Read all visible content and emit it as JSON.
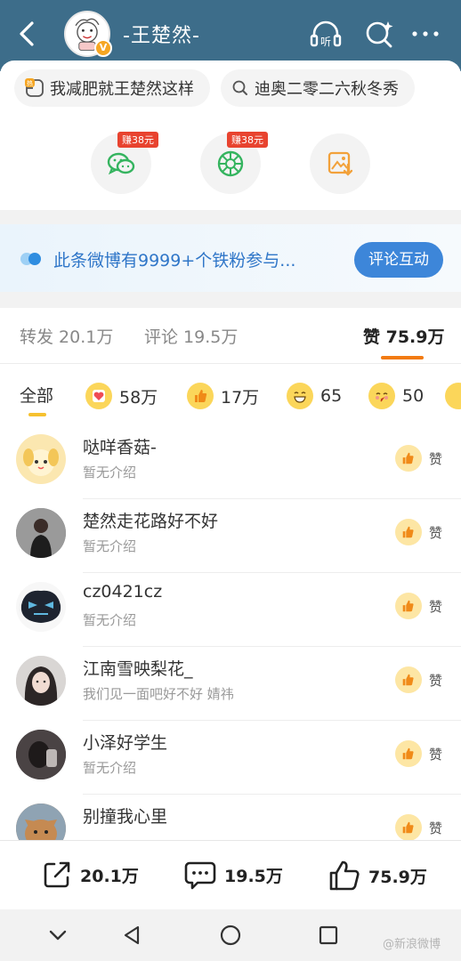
{
  "header": {
    "title": "-王楚然-",
    "verified_badge": "V"
  },
  "topics": [
    {
      "label": "我减肥就王楚然这样",
      "icon": "hot-badge-icon"
    },
    {
      "label": "迪奥二零二六秋冬秀",
      "icon": "search-icon"
    }
  ],
  "share": [
    {
      "name": "wechat-icon",
      "reward": "赚38元",
      "color": "#35b45f"
    },
    {
      "name": "moments-icon",
      "reward": "赚38元",
      "color": "#35b45f"
    },
    {
      "name": "save-image-icon",
      "reward": "",
      "color": "#f2a13a"
    }
  ],
  "banner": {
    "text": "此条微博有9999+个铁粉参与...",
    "button": "评论互动"
  },
  "stats": {
    "repost_label": "转发 20.1万",
    "comment_label": "评论 19.5万",
    "like_label": "赞 75.9万"
  },
  "filters": [
    {
      "label": "全部",
      "icon": ""
    },
    {
      "label": "58万",
      "icon": "heart-emoji-icon"
    },
    {
      "label": "17万",
      "icon": "thumb-emoji-icon"
    },
    {
      "label": "65",
      "icon": "laugh-emoji-icon"
    },
    {
      "label": "50",
      "icon": "kiss-emoji-icon"
    }
  ],
  "likers": [
    {
      "name": "哒咩香菇-",
      "desc": "暂无介绍",
      "like": "赞",
      "avatar_color": "#fbe7b0"
    },
    {
      "name": "楚然走花路好不好",
      "desc": "暂无介绍",
      "like": "赞",
      "avatar_color": "#5b5b5b"
    },
    {
      "name": "cz0421cz",
      "desc": "暂无介绍",
      "like": "赞",
      "avatar_color": "#2a2f3c"
    },
    {
      "name": "江南雪映梨花_",
      "desc": "我们见一面吧好不好 婧祎",
      "like": "赞",
      "avatar_color": "#c9c3c0"
    },
    {
      "name": "小泽好学生",
      "desc": "暂无介绍",
      "like": "赞",
      "avatar_color": "#3b3536"
    },
    {
      "name": "别撞我心里",
      "desc": "",
      "like": "赞",
      "avatar_color": "#c58a52"
    }
  ],
  "bottom_bar": {
    "repost": "20.1万",
    "comment": "19.5万",
    "like": "75.9万"
  },
  "watermark": "@新浪微博"
}
